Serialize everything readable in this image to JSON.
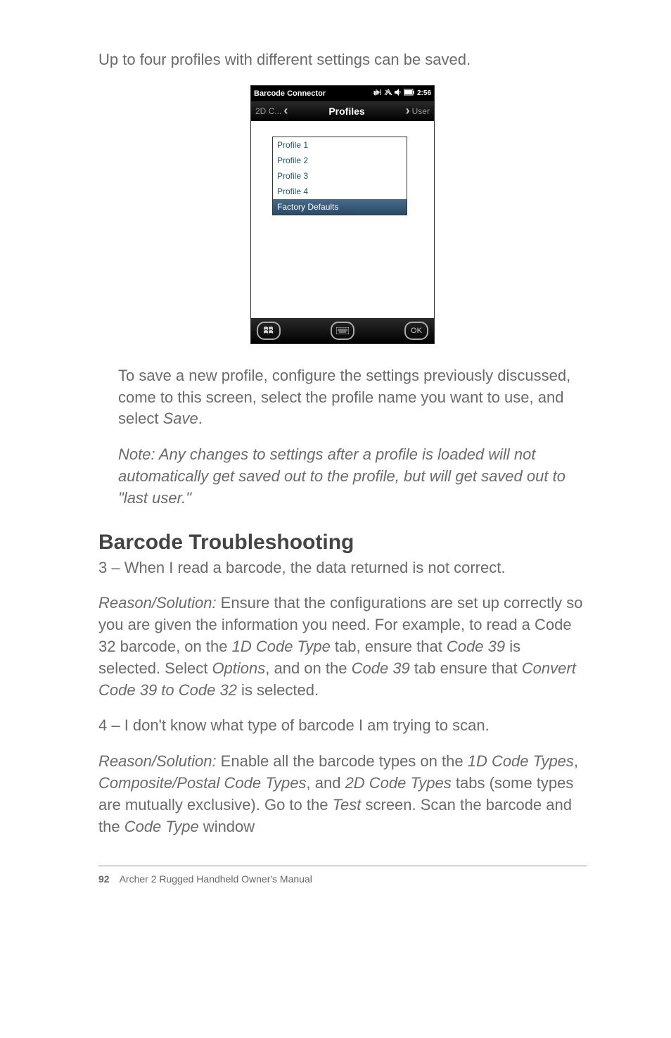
{
  "intro": "Up to four profiles with different settings can be saved.",
  "screenshot": {
    "title": "Barcode Connector",
    "clock": "2:56",
    "tab_left": "2D C...",
    "tab_center": "Profiles",
    "tab_right": "User",
    "items": {
      "i1": "Profile 1",
      "i2": "Profile 2",
      "i3": "Profile 3",
      "i4": "Profile 4",
      "i5": "Factory Defaults"
    },
    "ok": "OK"
  },
  "save_profile": {
    "t1": "To save a new profile, configure the settings previously discussed, come to this screen, select the profile name you want to use, and select ",
    "t2": "Save",
    "t3": "."
  },
  "note": "Note: Any changes to settings after a profile is loaded will not automatically get saved out to the profile, but will get saved out to \"last user.\"",
  "heading": "Barcode Troubleshooting",
  "q3": "3 – When I read a barcode, the data returned is not correct.",
  "a3": {
    "t1": "Reason/Solution:",
    "t2": " Ensure that the configurations are set up correctly so you are given the information you need. For example, to read a Code 32 barcode, on the ",
    "t3": "1D Code Type",
    "t4": " tab, ensure that ",
    "t5": "Code 39",
    "t6": " is selected. Select ",
    "t7": "Options",
    "t8": ", and on the ",
    "t9": "Code 39",
    "t10": " tab ensure that ",
    "t11": "Convert Code 39 to Code 32",
    "t12": " is selected."
  },
  "q4": "4 – I don't know what type of barcode I am trying to scan.",
  "a4": {
    "t1": "Reason/Solution:",
    "t2": " Enable all the barcode types on the ",
    "t3": "1D Code Types",
    "t4": ", ",
    "t5": "Composite/Postal Code Types",
    "t6": ", and ",
    "t7": "2D Code Types",
    "t8": " tabs (some types are mutually exclusive). Go to the ",
    "t9": "Test",
    "t10": " screen. Scan the barcode and the ",
    "t11": "Code Type",
    "t12": " window"
  },
  "footer": {
    "page": "92",
    "title": "Archer 2 Rugged Handheld Owner's Manual"
  }
}
